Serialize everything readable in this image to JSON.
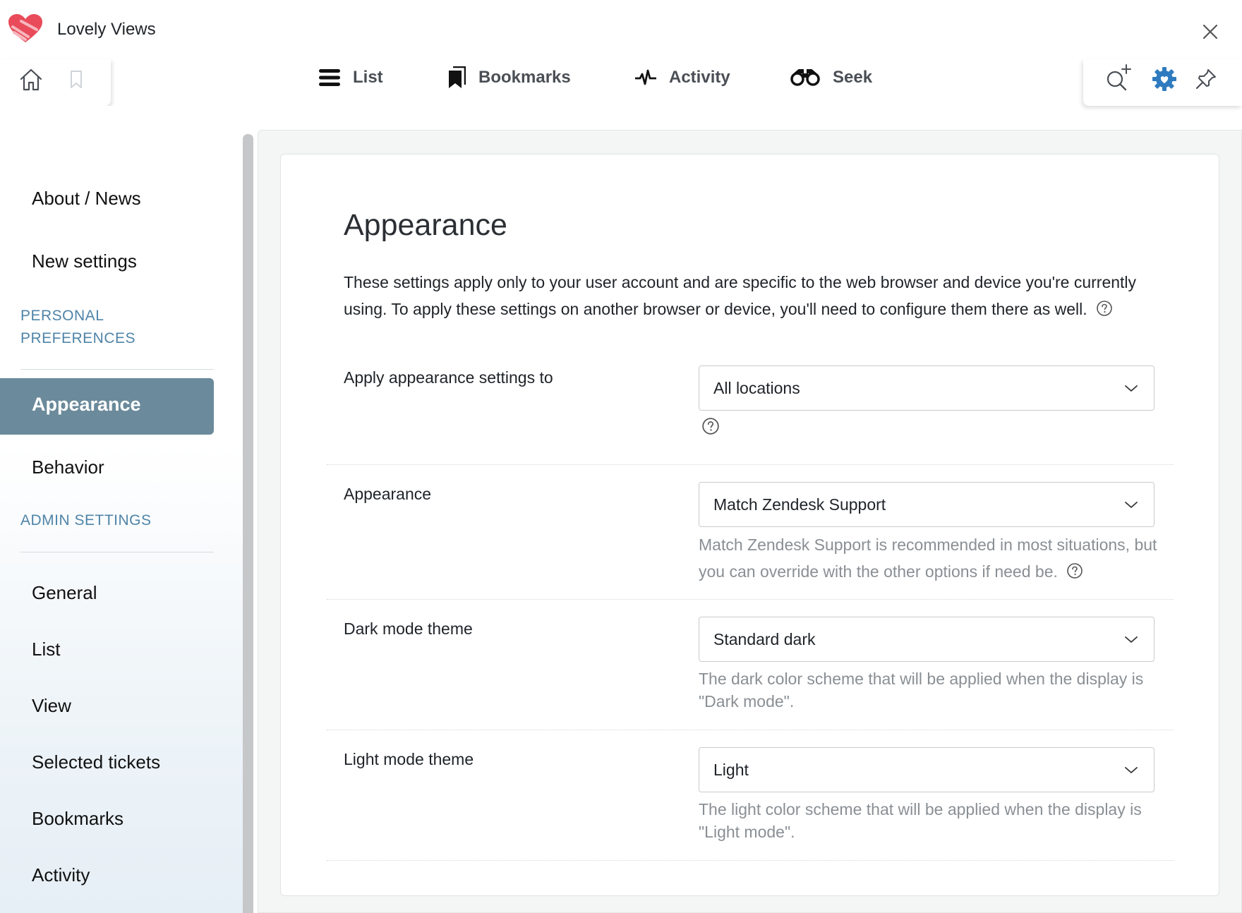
{
  "app": {
    "title": "Lovely Views"
  },
  "nav": {
    "list": "List",
    "bookmarks": "Bookmarks",
    "activity": "Activity",
    "seek": "Seek"
  },
  "sidebar": {
    "items_top": [
      "About / News",
      "New settings"
    ],
    "section_personal": "PERSONAL\nPREFERENCES",
    "active_item": "Appearance",
    "behavior": "Behavior",
    "section_admin": "ADMIN SETTINGS",
    "admin_items": [
      "General",
      "List",
      "View",
      "Selected tickets",
      "Bookmarks",
      "Activity"
    ]
  },
  "page": {
    "title": "Appearance",
    "intro": "These settings apply only to your user account and are specific to the web browser and device you're currently using. To apply these settings on another browser or device, you'll need to configure them there as well."
  },
  "settings": [
    {
      "label": "Apply appearance settings to",
      "value": "All locations",
      "hint": ""
    },
    {
      "label": "Appearance",
      "value": "Match Zendesk Support",
      "hint": "Match Zendesk Support is recommended in most situations, but you can override with the other options if need be."
    },
    {
      "label": "Dark mode theme",
      "value": "Standard dark",
      "hint": "The dark color scheme that will be applied when the display is \"Dark mode\"."
    },
    {
      "label": "Light mode theme",
      "value": "Light",
      "hint": "The light color scheme that will be applied when the display is \"Light mode\"."
    }
  ],
  "colors": {
    "accent": "#2f7bbf",
    "sidebar_active_bg": "#6b8a9b",
    "section_heading": "#4f84a8",
    "hint_text": "#8a8f94"
  },
  "icons": {
    "logo": "heart-logo-icon",
    "close": "close-icon",
    "home": "home-icon",
    "bookmark": "bookmark-icon",
    "list": "list-icon",
    "bookmarks": "bookmarks-icon",
    "activity": "activity-icon",
    "seek": "binoculars-icon",
    "search_add": "search-plus-icon",
    "settings": "gear-icon",
    "pin": "pin-icon",
    "help": "help-icon",
    "chevron": "chevron-down-icon"
  }
}
